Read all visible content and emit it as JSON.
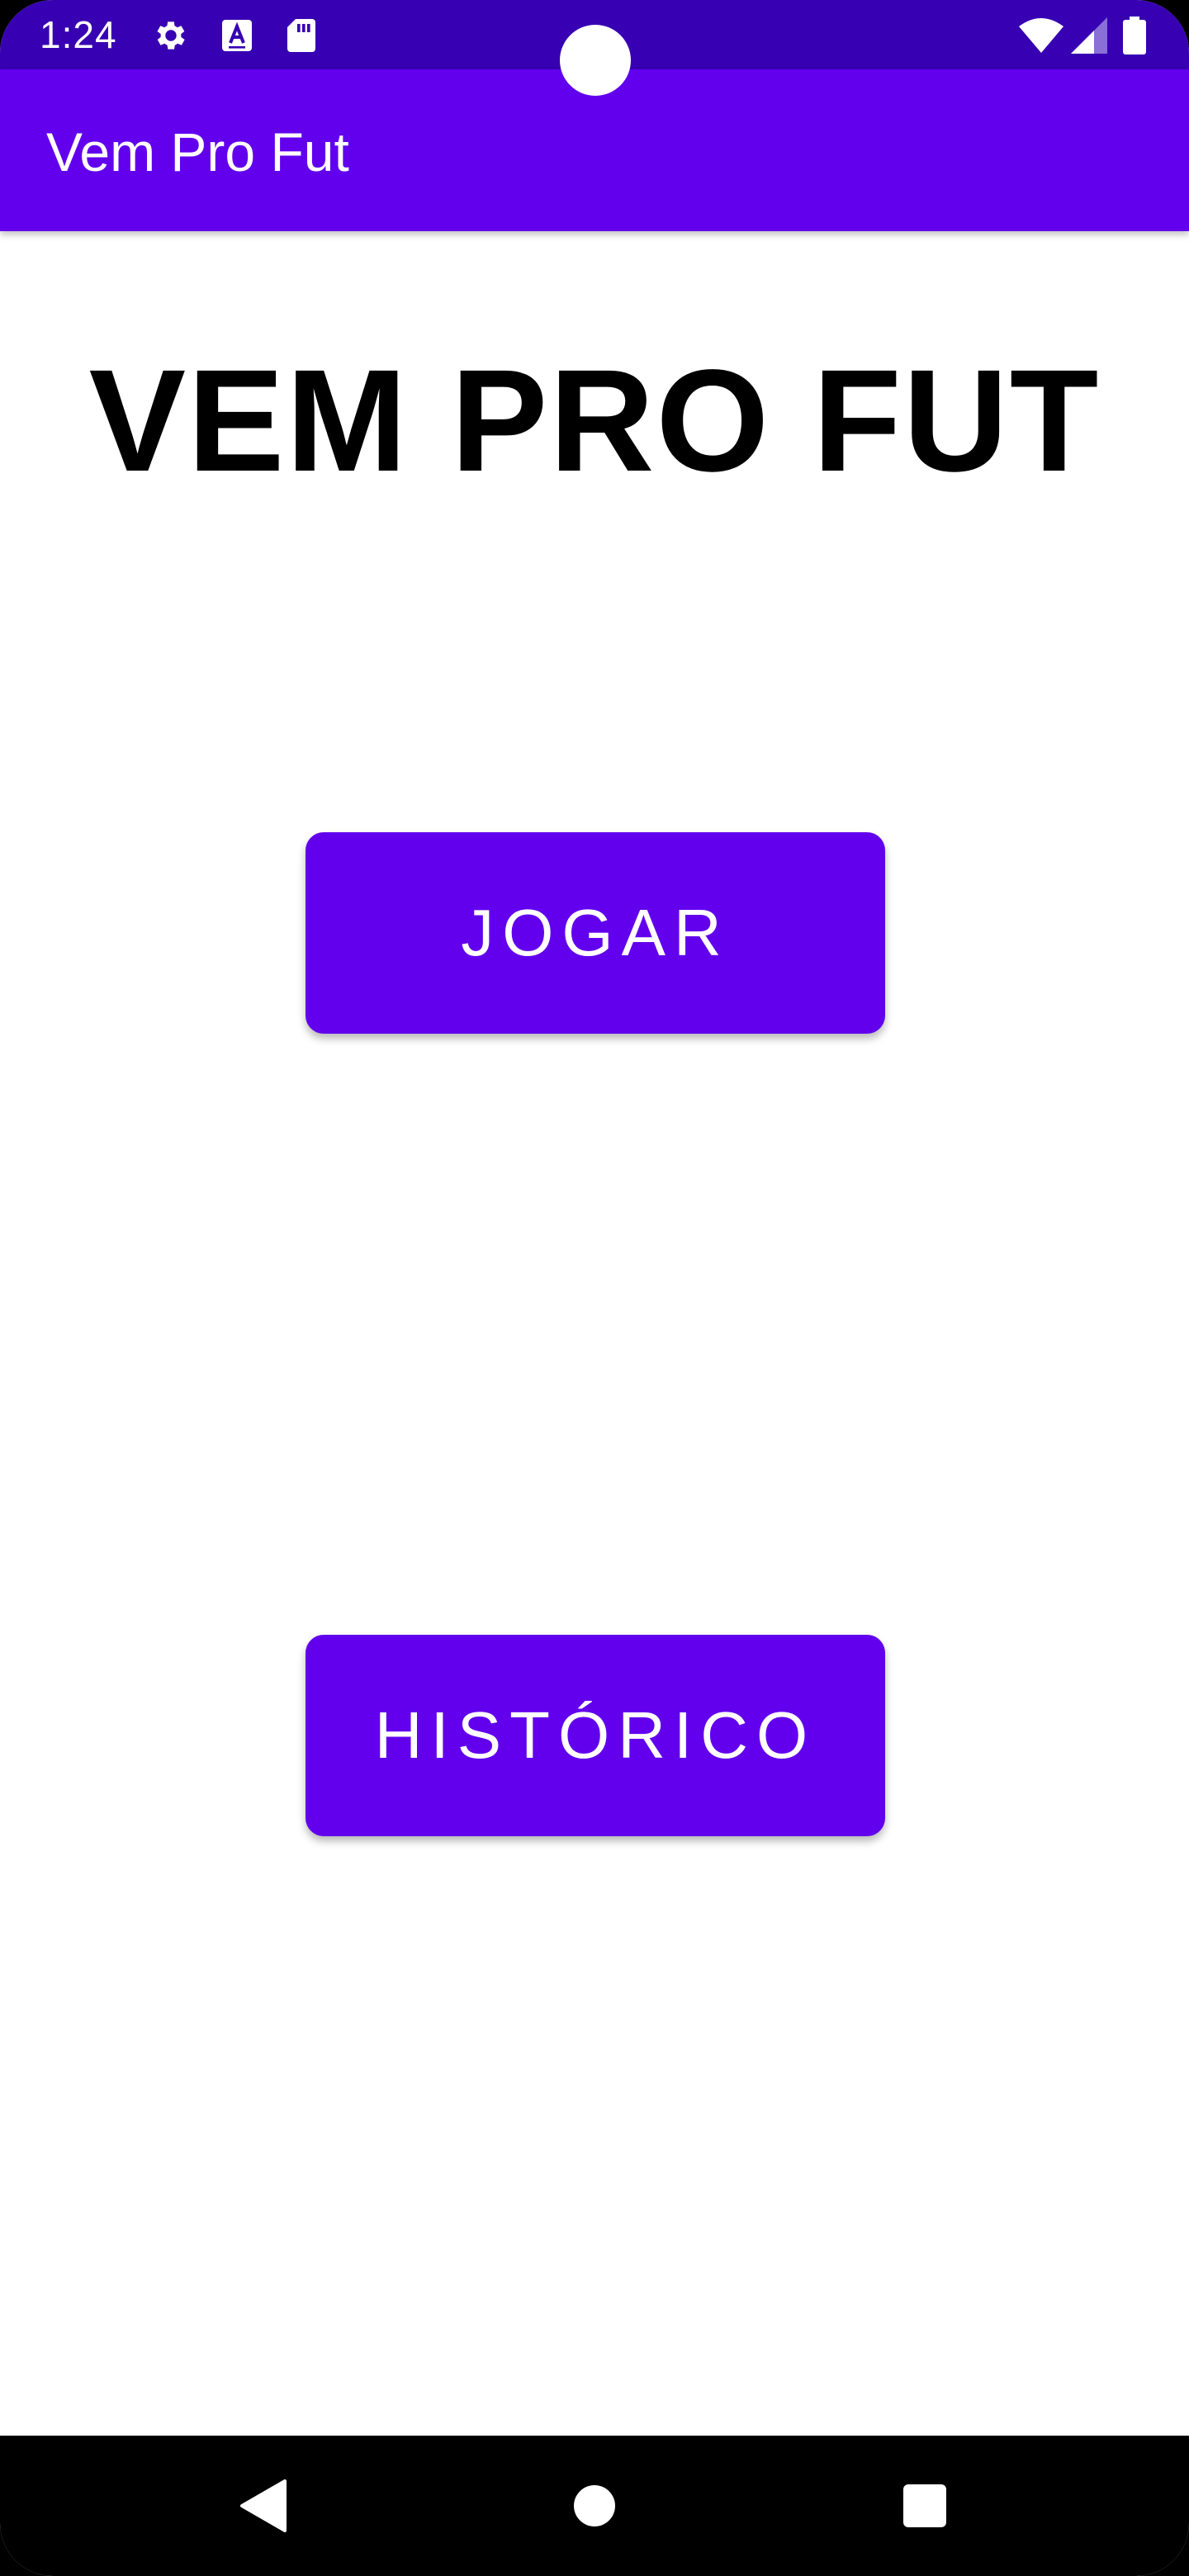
{
  "status_bar": {
    "time": "1:24",
    "left_icons": [
      "gear-icon",
      "keyboard-a-icon",
      "sd-card-icon"
    ],
    "right_icons": [
      "wifi-icon",
      "signal-icon",
      "battery-icon"
    ],
    "background": "#3700b3"
  },
  "app_bar": {
    "title": "Vem Pro Fut",
    "background": "#6200ee"
  },
  "main": {
    "headline": "VEM PRO FUT",
    "play_button_label": "JOGAR",
    "history_button_label": "HISTÓRICO",
    "button_color": "#6200ee"
  },
  "nav_bar": {
    "buttons": [
      "back-icon",
      "home-icon",
      "recents-icon"
    ]
  }
}
